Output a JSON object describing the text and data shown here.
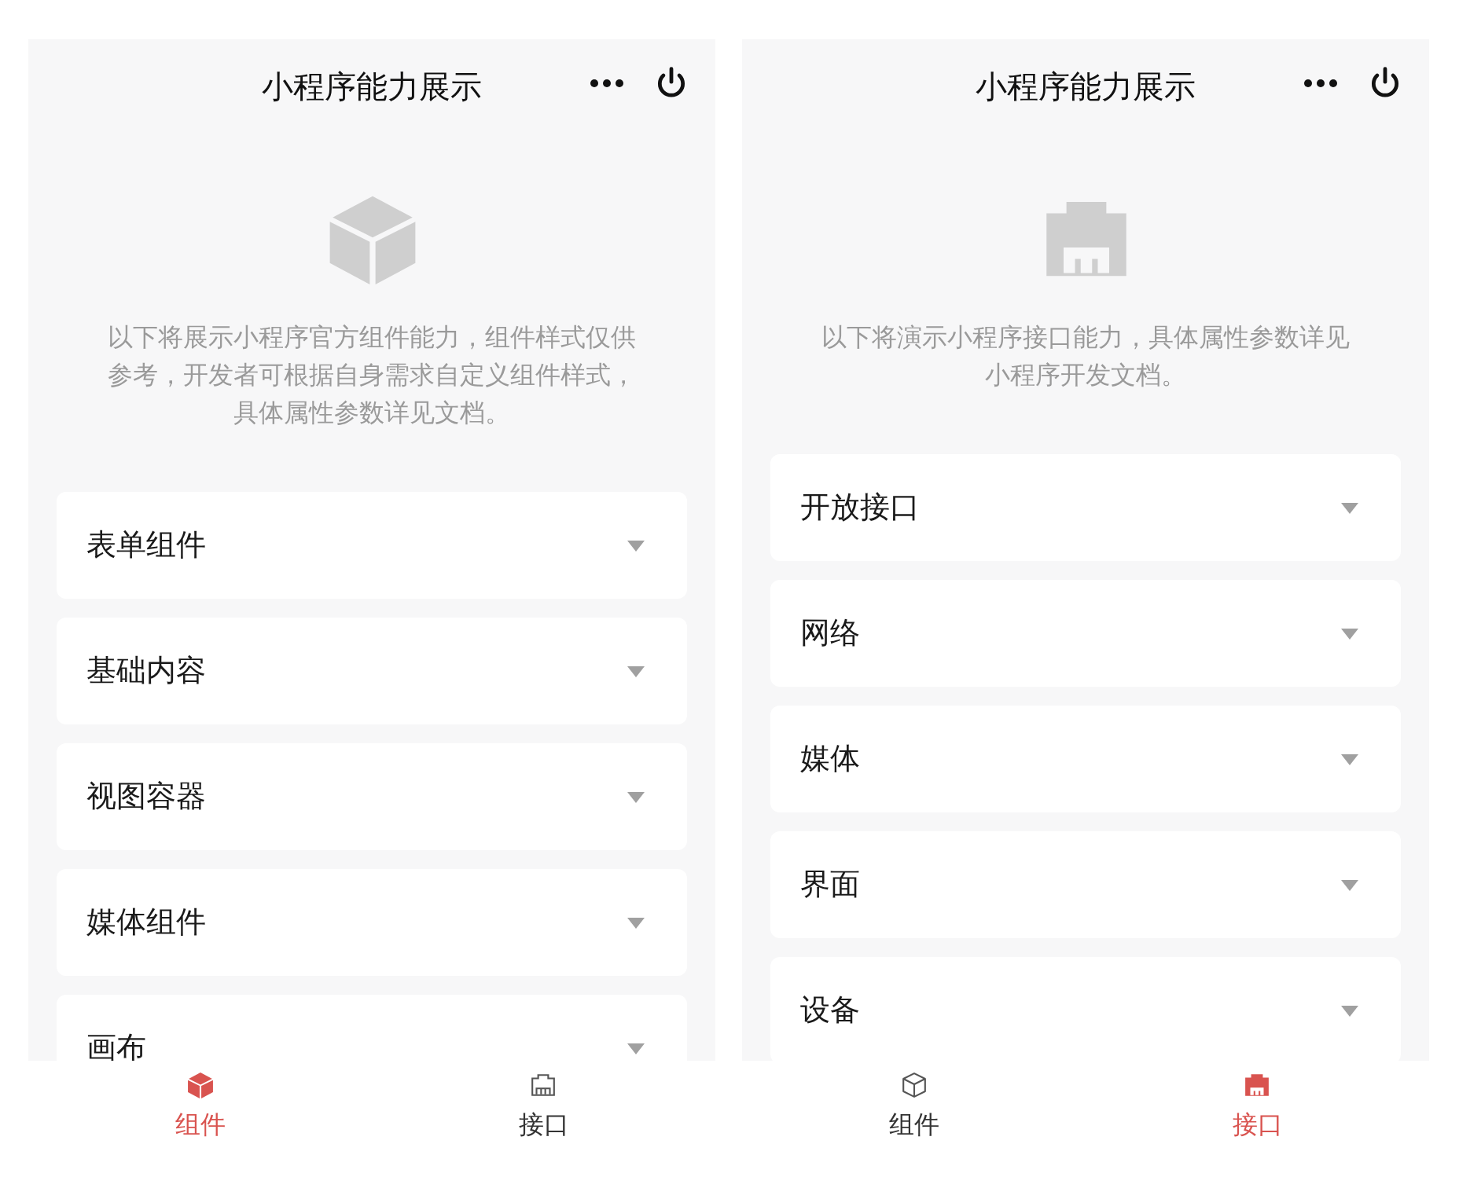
{
  "screens": [
    {
      "title": "小程序能力展示",
      "description": "以下将展示小程序官方组件能力，组件样式仅供参考，开发者可根据自身需求自定义组件样式，具体属性参数详见文档。",
      "sections": [
        {
          "label": "表单组件"
        },
        {
          "label": "基础内容"
        },
        {
          "label": "视图容器"
        },
        {
          "label": "媒体组件"
        },
        {
          "label": "画布"
        }
      ],
      "tabs": [
        {
          "label": "组件",
          "selected": true
        },
        {
          "label": "接口",
          "selected": false
        }
      ]
    },
    {
      "title": "小程序能力展示",
      "description": "以下将演示小程序接口能力，具体属性参数详见小程序开发文档。",
      "sections": [
        {
          "label": "开放接口"
        },
        {
          "label": "网络"
        },
        {
          "label": "媒体"
        },
        {
          "label": "界面"
        },
        {
          "label": "设备"
        }
      ],
      "tabs": [
        {
          "label": "组件",
          "selected": false
        },
        {
          "label": "接口",
          "selected": true
        }
      ]
    }
  ]
}
